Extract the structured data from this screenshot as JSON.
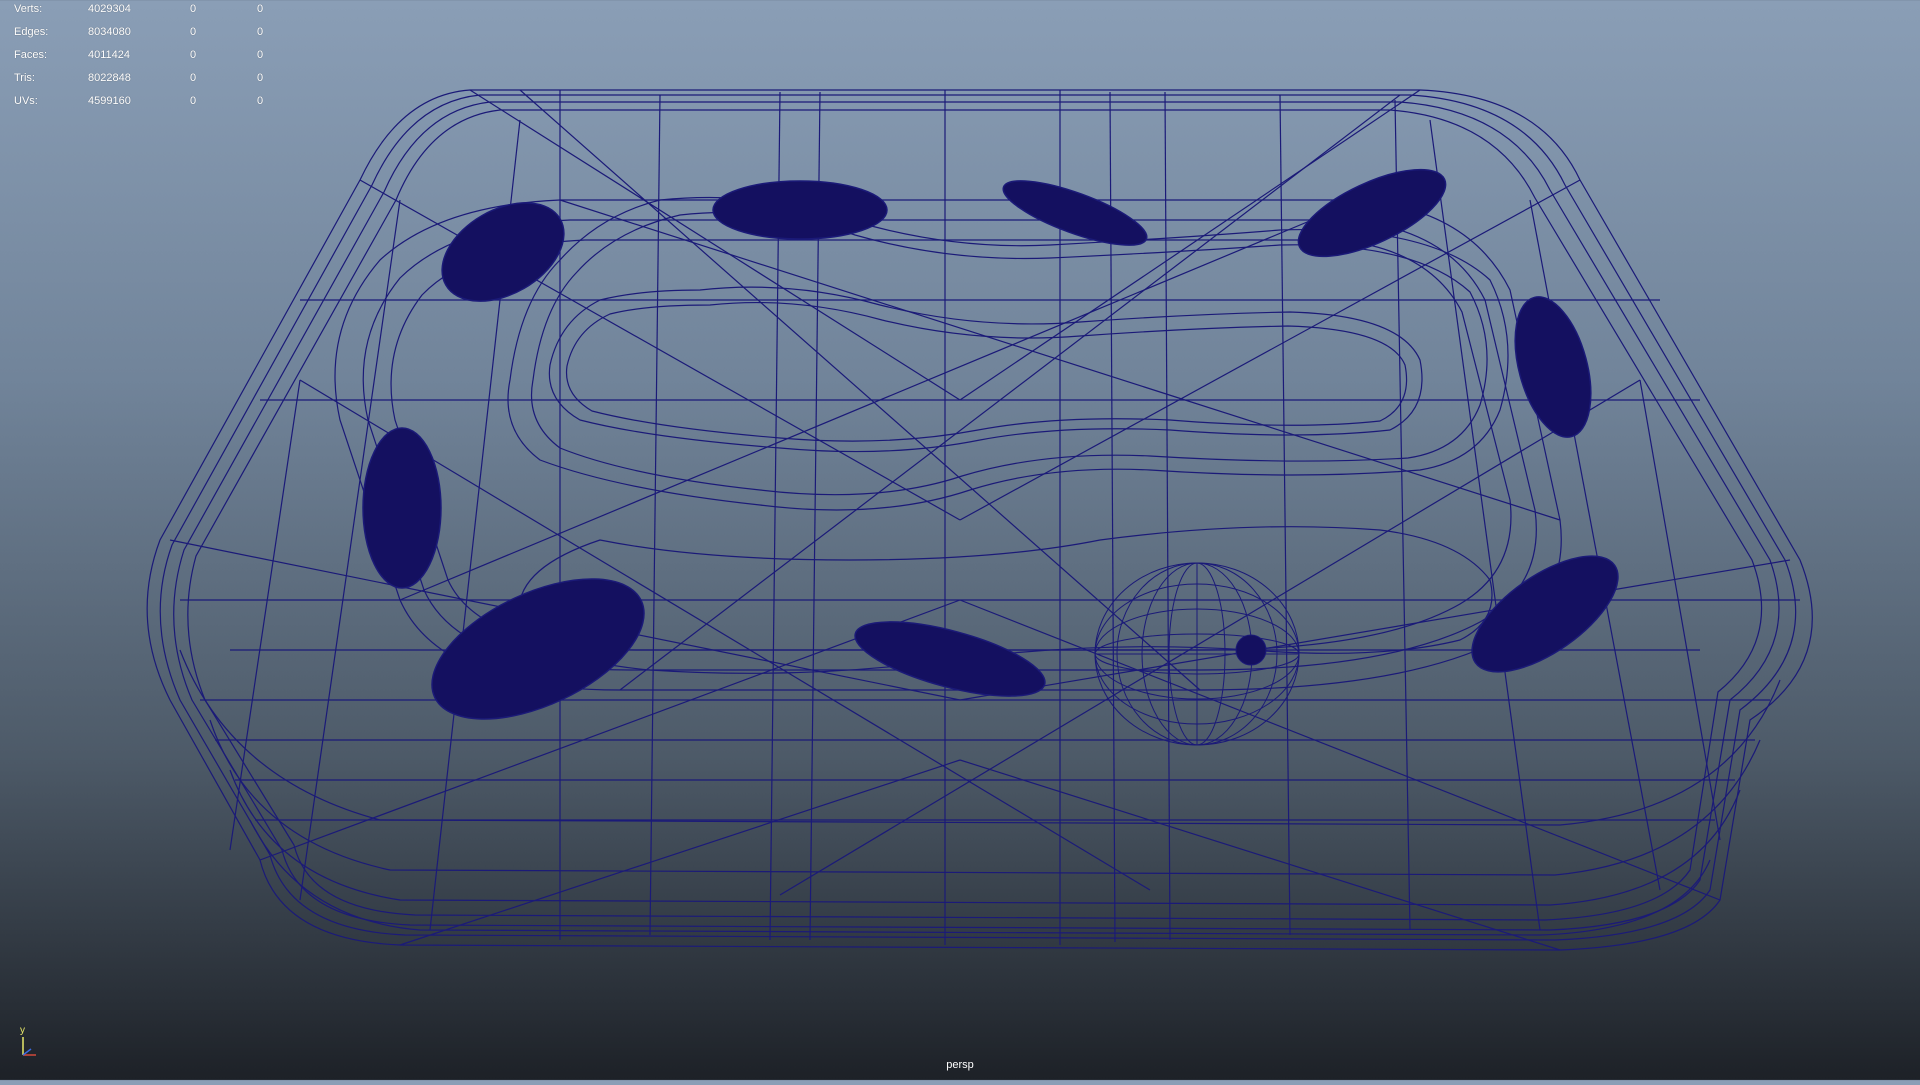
{
  "hud": {
    "rows": [
      {
        "label": "Verts:",
        "total": "4029304",
        "sel": "0",
        "sel2": "0"
      },
      {
        "label": "Edges:",
        "total": "8034080",
        "sel": "0",
        "sel2": "0"
      },
      {
        "label": "Faces:",
        "total": "4011424",
        "sel": "0",
        "sel2": "0"
      },
      {
        "label": "Tris:",
        "total": "8022848",
        "sel": "0",
        "sel2": "0"
      },
      {
        "label": "UVs:",
        "total": "4599160",
        "sel": "0",
        "sel2": "0"
      }
    ]
  },
  "camera": {
    "name": "persp"
  },
  "axis": {
    "up_label": "y"
  },
  "colors": {
    "wire": "#1b1a78",
    "wire_dense": "#141060",
    "axis_y": "#e8e86a",
    "axis_x": "#d0493b",
    "axis_z": "#3a6be0"
  }
}
